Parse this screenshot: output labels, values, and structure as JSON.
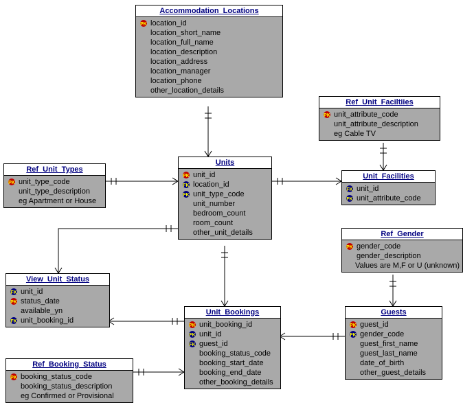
{
  "entities": {
    "accommodation_locations": {
      "title": "Accommodation_Locations",
      "attrs": [
        {
          "k": "pk",
          "n": "location_id"
        },
        {
          "k": "",
          "n": "location_short_name"
        },
        {
          "k": "",
          "n": "location_full_name"
        },
        {
          "k": "",
          "n": "location_description"
        },
        {
          "k": "",
          "n": "location_address"
        },
        {
          "k": "",
          "n": "location_manager"
        },
        {
          "k": "",
          "n": "location_phone"
        },
        {
          "k": "",
          "n": "other_location_details"
        }
      ]
    },
    "ref_unit_facilities": {
      "title": "Ref_Unit_Faciltiies",
      "attrs": [
        {
          "k": "pk",
          "n": "unit_attribute_code"
        },
        {
          "k": "",
          "n": "unit_attribute_description"
        },
        {
          "k": "",
          "n": "eg Cable TV"
        }
      ]
    },
    "ref_unit_types": {
      "title": "Ref_Unit_Types",
      "attrs": [
        {
          "k": "pk",
          "n": "unit_type_code"
        },
        {
          "k": "",
          "n": "unit_type_description"
        },
        {
          "k": "",
          "n": "eg Apartment or House"
        }
      ]
    },
    "units": {
      "title": "Units",
      "attrs": [
        {
          "k": "pk",
          "n": "unit_id"
        },
        {
          "k": "fk",
          "n": "location_id"
        },
        {
          "k": "fk",
          "n": "unit_type_code"
        },
        {
          "k": "",
          "n": "unit_number"
        },
        {
          "k": "",
          "n": "bedroom_count"
        },
        {
          "k": "",
          "n": "room_count"
        },
        {
          "k": "",
          "n": "other_unit_details"
        }
      ]
    },
    "unit_facilities": {
      "title": "Unit_Facilities",
      "attrs": [
        {
          "k": "fk",
          "n": "unit_id"
        },
        {
          "k": "fk",
          "n": "unit_attribute_code"
        }
      ]
    },
    "ref_gender": {
      "title": "Ref_Gender",
      "attrs": [
        {
          "k": "pk",
          "n": "gender_code"
        },
        {
          "k": "",
          "n": "gender_description"
        },
        {
          "k": "",
          "n": "Values are M,F or U (unknown)"
        }
      ]
    },
    "view_unit_status": {
      "title": "View_Unit_Status",
      "attrs": [
        {
          "k": "fk",
          "n": "unit_id"
        },
        {
          "k": "pk",
          "n": "status_date"
        },
        {
          "k": "",
          "n": "available_yn"
        },
        {
          "k": "fk",
          "n": "unit_booking_id"
        }
      ]
    },
    "unit_bookings": {
      "title": "Unit_Bookings",
      "attrs": [
        {
          "k": "pk",
          "n": "unit_booking_id"
        },
        {
          "k": "fk",
          "n": "unit_id"
        },
        {
          "k": "fk",
          "n": "guest_id"
        },
        {
          "k": "",
          "n": "booking_status_code"
        },
        {
          "k": "",
          "n": "booking_start_date"
        },
        {
          "k": "",
          "n": "booking_end_date"
        },
        {
          "k": "",
          "n": "other_booking_details"
        }
      ]
    },
    "guests": {
      "title": "Guests",
      "attrs": [
        {
          "k": "pk",
          "n": "guest_id"
        },
        {
          "k": "fk",
          "n": "gender_code"
        },
        {
          "k": "",
          "n": "guest_first_name"
        },
        {
          "k": "",
          "n": "guest_last_name"
        },
        {
          "k": "",
          "n": "date_of_birth"
        },
        {
          "k": "",
          "n": "other_guest_details"
        }
      ]
    },
    "ref_booking_status": {
      "title": "Ref_Booking_Status",
      "attrs": [
        {
          "k": "pk",
          "n": "booking_status_code"
        },
        {
          "k": "",
          "n": "booking_status_description"
        },
        {
          "k": "",
          "n": "eg Confirmed or Provisional"
        }
      ]
    }
  }
}
